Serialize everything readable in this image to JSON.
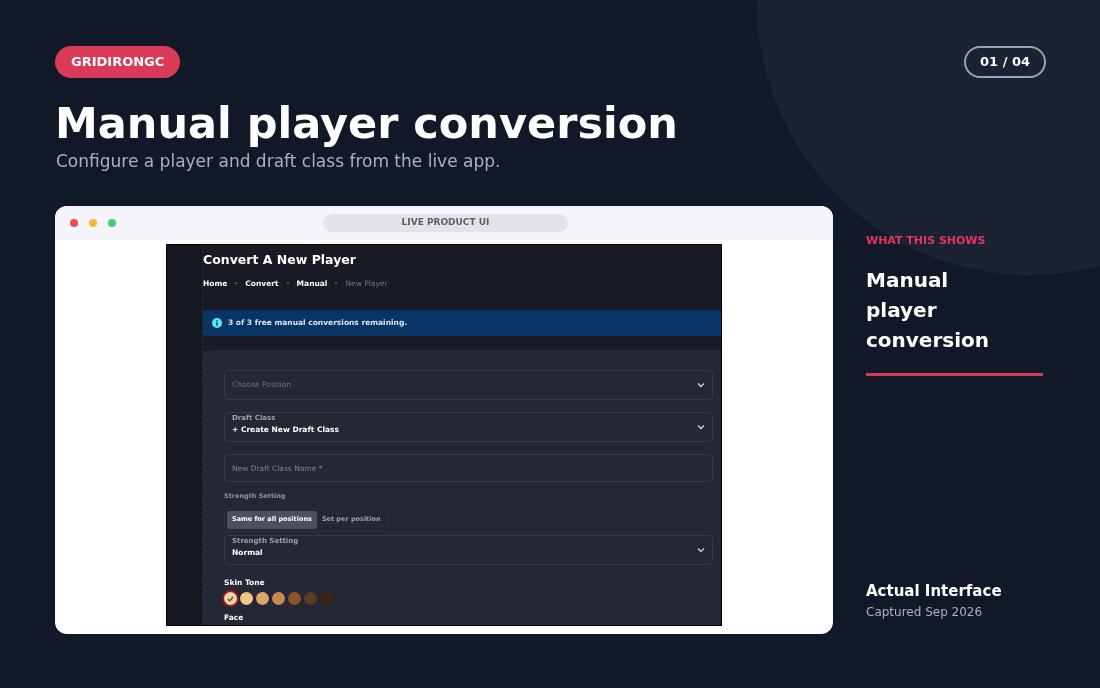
{
  "badge": "GRIDIRONGC",
  "counter": "01 / 04",
  "title": "Manual player conversion",
  "subtitle": "Configure a player and draft class from the live app.",
  "browser": {
    "address": "LIVE PRODUCT UI"
  },
  "app": {
    "heading": "Convert A New Player",
    "breadcrumbs": [
      {
        "label": "Home",
        "current": false
      },
      {
        "label": "Convert",
        "current": false
      },
      {
        "label": "Manual",
        "current": false
      },
      {
        "label": "New Player",
        "current": true
      }
    ],
    "alert": "3 of 3 free manual conversions remaining.",
    "position_select": {
      "placeholder": "Choose Position"
    },
    "draft_class_select": {
      "label": "Draft Class",
      "value": "+ Create New Draft Class"
    },
    "draft_class_name": {
      "placeholder": "New Draft Class Name *"
    },
    "strength_label": "Strength Setting",
    "strength_modes": [
      {
        "label": "Same for all positions",
        "selected": true
      },
      {
        "label": "Set per position",
        "selected": false
      }
    ],
    "strength_select": {
      "label": "Strength Setting",
      "value": "Normal"
    },
    "skin_tone_label": "Skin Tone",
    "skin_tones": [
      {
        "color": "#f3d3a6",
        "selected": true
      },
      {
        "color": "#eec489",
        "selected": false
      },
      {
        "color": "#dba56c",
        "selected": false
      },
      {
        "color": "#c9894c",
        "selected": false
      },
      {
        "color": "#8e5428",
        "selected": false
      },
      {
        "color": "#5c3a22",
        "selected": false
      },
      {
        "color": "#3a2616",
        "selected": false
      }
    ],
    "face_label": "Face"
  },
  "side": {
    "eyebrow": "WHAT THIS SHOWS",
    "heading": "Manual player conversion",
    "footer_title": "Actual Interface",
    "footer_note": "Captured Sep 2026"
  }
}
